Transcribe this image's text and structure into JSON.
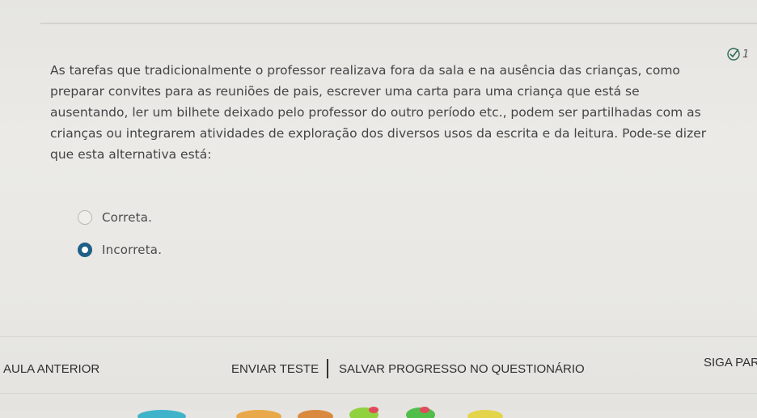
{
  "question": {
    "number": "1",
    "lines": [
      "As tarefas que tradicionalmente o professor realizava fora da sala e na ausência das crianças, como",
      "preparar convites para as reuniões de pais, escrever uma carta para uma criança que está se",
      "ausentando, ler um bilhete deixado pelo professor do outro período etc., podem ser partilhadas com as",
      "crianças ou integrarem atividades de exploração dos diversos usos da escrita e da leitura. Pode-se dizer",
      "que esta alternativa está:"
    ]
  },
  "options": [
    {
      "label": "Correta.",
      "selected": false
    },
    {
      "label": "Incorreta.",
      "selected": true
    }
  ],
  "footer": {
    "prev_label": "AULA ANTERIOR",
    "send_label": "ENVIAR TESTE",
    "save_label": "SALVAR PROGRESSO NO QUESTIONÁRIO",
    "next_label": "SIGA PAR"
  },
  "colors": {
    "selected_radio": "#1f5f86",
    "check_icon": "#2e6b57"
  },
  "icons": {
    "answered": "check-circle-icon"
  }
}
